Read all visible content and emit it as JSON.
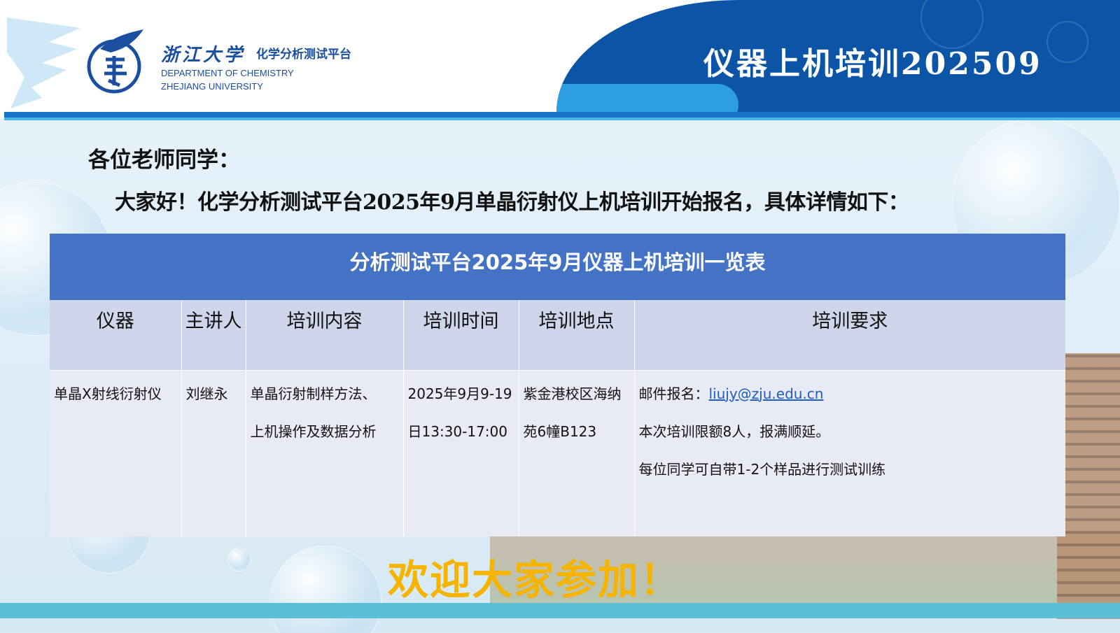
{
  "header": {
    "university_script": "浙江大学",
    "platform_name": "化学分析测试平台",
    "dept_line1": "DEPARTMENT OF CHEMISTRY",
    "dept_line2": "ZHEJIANG UNIVERSITY",
    "title": "仪器上机培训202509"
  },
  "greeting": {
    "salutation": "各位老师同学：",
    "intro": "大家好！化学分析测试平台2025年9月单晶衍射仪上机培训开始报名，具体详情如下："
  },
  "table": {
    "caption": "分析测试平台2025年9月仪器上机培训一览表",
    "headers": [
      "仪器",
      "主讲人",
      "培训内容",
      "培训时间",
      "培训地点",
      "培训要求"
    ],
    "row": {
      "instrument": "单晶X射线衍射仪",
      "lecturer": "刘继永",
      "content_line1": "单晶衍射制样方法、",
      "content_line2": "上机操作及数据分析",
      "time_line1": "2025年9月9-19",
      "time_line2": "日13:30-17:00",
      "location_line1": "紫金港校区海纳",
      "location_line2": "苑6幢B123",
      "req_email_label": "邮件报名：",
      "req_email": "liujy@zju.edu.cn",
      "req_line2": "本次培训限额8人，报满顺延。",
      "req_line3": "每位同学可自带1-2个样品进行测试训练"
    }
  },
  "footer": {
    "welcome": "欢迎大家参加！"
  },
  "colors": {
    "header_blue": "#0c55a6",
    "table_caption": "#4472c4",
    "table_header": "#cfd5ea",
    "table_body": "#e8ebf5",
    "welcome": "#f5b400"
  }
}
